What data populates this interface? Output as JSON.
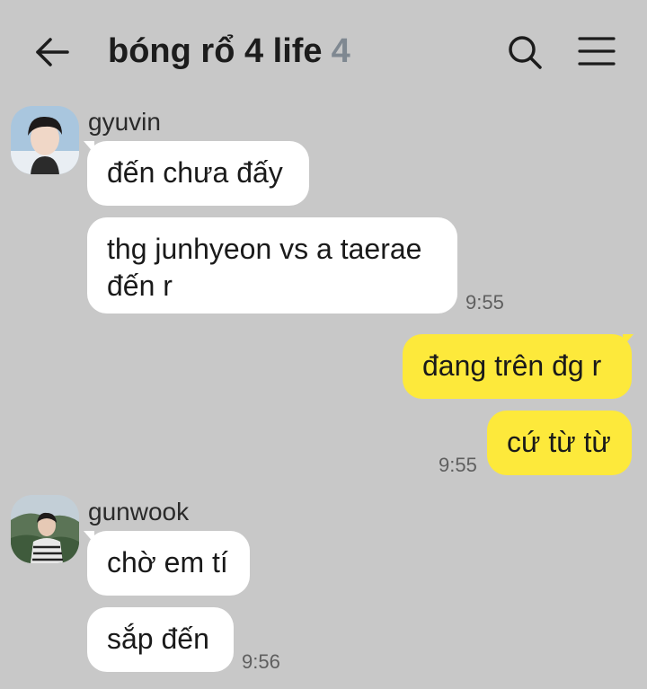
{
  "header": {
    "title": "bóng rổ 4 life",
    "member_count": "4",
    "icons": {
      "back": "arrow-left-icon",
      "search": "search-icon",
      "menu": "hamburger-menu-icon"
    }
  },
  "colors": {
    "background": "#c8c8c8",
    "incoming_bubble": "#ffffff",
    "outgoing_bubble": "#fde93b",
    "member_count": "#7f8891"
  },
  "messages": {
    "group1": {
      "sender": "gyuvin",
      "bubbles": [
        "đến chưa đấy",
        "thg junhyeon vs a taerae đến r"
      ],
      "time": "9:55"
    },
    "mine": {
      "bubbles": [
        "đang trên đg r",
        "cứ từ từ"
      ],
      "time": "9:55"
    },
    "group2": {
      "sender": "gunwook",
      "bubbles": [
        "chờ em tí",
        "sắp đến"
      ],
      "time": "9:56"
    }
  }
}
